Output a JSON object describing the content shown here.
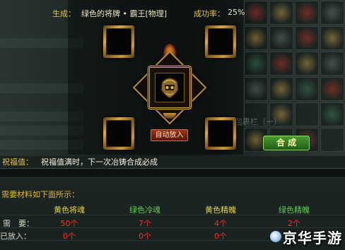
{
  "header": {
    "output_label": "生成：",
    "output_item": "绿色的将牌 • 霸王[物理]",
    "success_label": "成功率：",
    "success_rate": "25%"
  },
  "background": {
    "bag_title": "包裹栏（一）"
  },
  "buttons": {
    "auto_fill": "自动放入",
    "craft": "合 成"
  },
  "blessing": {
    "label": "祝福值：",
    "description": "祝福值满时，下一次冶铸合成必成"
  },
  "materials": {
    "title": "需要材料如下面所示：",
    "columns": [
      "黄色将魂",
      "绿色冷魂",
      "黄色精魄",
      "绿色精魄"
    ],
    "required_label": "需　要：",
    "required": [
      "50个",
      "7个",
      "4个",
      "2个"
    ],
    "placed_label": "已放入：",
    "placed": [
      "0个",
      "0个",
      "0个"
    ]
  },
  "watermark": {
    "text": "京华手游"
  },
  "icons": {
    "center_item": "helmet-icon",
    "flame": "flame-icon",
    "watermark_logo": "logo-icon"
  },
  "colors": {
    "label_gold": "#e8c040",
    "value_red": "#ff2e1e",
    "yellow_material": "#e8d44a",
    "green_material": "#5ed04a",
    "craft_button": "#2f7a22",
    "auto_button": "#7a2212"
  }
}
